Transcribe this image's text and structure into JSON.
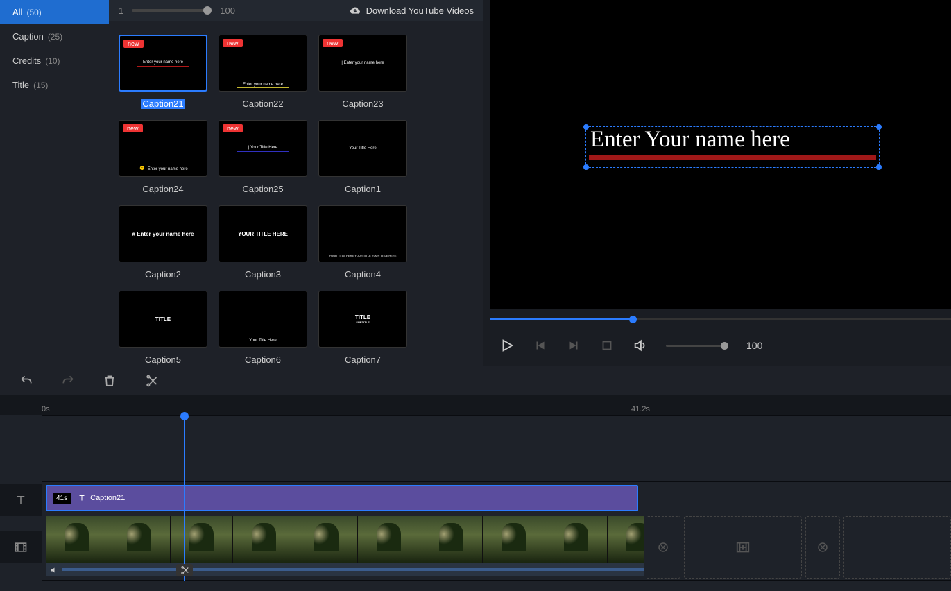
{
  "sidebar": {
    "items": [
      {
        "label": "All",
        "count": "(50)"
      },
      {
        "label": "Caption",
        "count": "(25)"
      },
      {
        "label": "Credits",
        "count": "(10)"
      },
      {
        "label": "Title",
        "count": "(15)"
      }
    ]
  },
  "header": {
    "slider_min": "1",
    "slider_max": "100",
    "download_label": "Download YouTube Videos"
  },
  "gallery": [
    {
      "label": "Caption21",
      "new": true,
      "selected": true,
      "txt": "Enter your name here",
      "line": "#b01818"
    },
    {
      "label": "Caption22",
      "new": true,
      "txt": "Enter your name here",
      "line": "#c4b830",
      "bottom": true
    },
    {
      "label": "Caption23",
      "new": true,
      "txt": "Enter your name here",
      "cursor": true
    },
    {
      "label": "Caption24",
      "new": true,
      "txt": "Enter your name here",
      "emoji": true,
      "bottom": true
    },
    {
      "label": "Caption25",
      "new": true,
      "txt": "Your Title Here",
      "line": "#3030c0",
      "cursor": true
    },
    {
      "label": "Caption1",
      "txt": "Your  Title Here"
    },
    {
      "label": "Caption2",
      "txt": "# Enter your name here",
      "bold": true
    },
    {
      "label": "Caption3",
      "txt": "YOUR TITLE HERE",
      "bold": true
    },
    {
      "label": "Caption4",
      "txt": "YOUR TITLE HERE YOUR TITLE YOUR TITLE HERE",
      "tiny": true,
      "bottom": true
    },
    {
      "label": "Caption5",
      "txt": "TITLE",
      "bold": true
    },
    {
      "label": "Caption6",
      "txt": "Your  Title Here",
      "bottom": true
    },
    {
      "label": "Caption7",
      "txt": "TITLE",
      "sub": "SUBTITLE",
      "bold": true
    }
  ],
  "preview": {
    "text": "Enter Your name here",
    "volume": "100"
  },
  "timeline": {
    "ruler": [
      {
        "pos": 60,
        "label": "0s"
      },
      {
        "pos": 910,
        "label": "41.2s"
      }
    ],
    "text_clip": {
      "duration": "41s",
      "name": "Caption21"
    }
  }
}
